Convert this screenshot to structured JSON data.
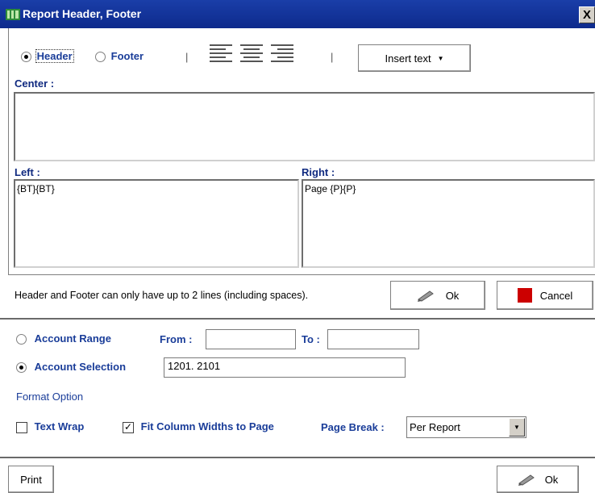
{
  "window": {
    "title": "Report Header, Footer",
    "close_label": "X",
    "app_icon": "grid-book-icon"
  },
  "section": {
    "header_label": "Header",
    "footer_label": "Footer",
    "separator": "|",
    "selected": "Header"
  },
  "toolbar": {
    "insert_text_label": "Insert text",
    "insert_text_arrow": "▼",
    "align_icons": [
      "align-left-icon",
      "align-center-icon",
      "align-right-icon"
    ]
  },
  "editor": {
    "center_label": "Center :",
    "center_value": "",
    "left_label": "Left :",
    "left_value": "{BT}{BT}",
    "right_label": "Right :",
    "right_value": "Page {P}{P}"
  },
  "footer_note": "Header and Footer can only have up to 2 lines (including spaces).",
  "dialog_buttons": {
    "ok_label": "Ok",
    "cancel_label": "Cancel",
    "cancel_color": "#cc0000"
  },
  "range": {
    "account_range_label": "Account Range",
    "from_label": "From :",
    "from_value": "",
    "to_label": "To :",
    "to_value": "",
    "account_selection_label": "Account Selection",
    "account_selection_value": "1201. 2101",
    "selected": "Account Selection"
  },
  "format": {
    "title": "Format Option",
    "text_wrap_label": "Text Wrap",
    "text_wrap_checked": false,
    "fit_columns_label": "Fit Column Widths to Page",
    "fit_columns_checked": true,
    "check_mark": "✓",
    "page_break_label": "Page Break :",
    "page_break_value": "Per Report",
    "dropdown_arrow": "▼"
  },
  "bottom": {
    "print_label": "Print",
    "ok_label": "Ok"
  }
}
